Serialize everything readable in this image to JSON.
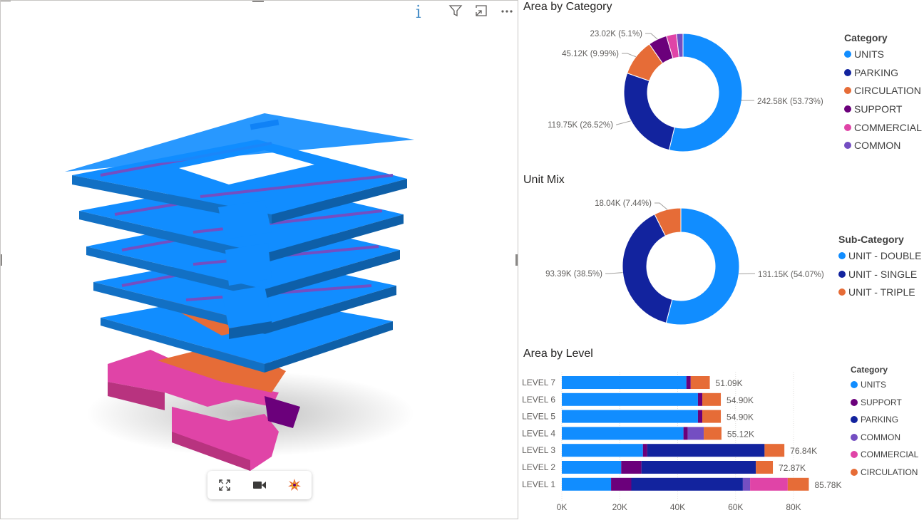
{
  "left_visual": {
    "info_glyph": "i",
    "header_icons": [
      "filter-icon",
      "focus-mode-icon",
      "more-options-icon"
    ],
    "toolbar_icons": [
      "expand-icon",
      "camera-icon",
      "explode-icon"
    ]
  },
  "colors": {
    "units": "#118DFF",
    "parking": "#12239E",
    "circulation": "#E66C37",
    "support": "#6B007B",
    "commercial": "#E044A7",
    "common": "#744EC2",
    "gridline": "#e1dfdd"
  },
  "chart_data": [
    {
      "type": "pie",
      "variant": "donut",
      "title": "Area by Category",
      "legend_title": "Category",
      "legend_position": "right",
      "categories": [
        "UNITS",
        "PARKING",
        "CIRCULATION",
        "SUPPORT",
        "COMMERCIAL",
        "COMMON"
      ],
      "values": [
        242.58,
        119.75,
        45.12,
        23.02,
        12.5,
        8.0
      ],
      "unit": "K",
      "data_labels": [
        "242.58K (53.73%)",
        "119.75K (26.52%)",
        "45.12K (9.99%)",
        "23.02K (5.1%)",
        "",
        ""
      ]
    },
    {
      "type": "pie",
      "variant": "donut",
      "title": "Unit Mix",
      "legend_title": "Sub-Category",
      "legend_position": "right",
      "categories": [
        "UNIT - DOUBLE",
        "UNIT - SINGLE",
        "UNIT - TRIPLE"
      ],
      "values": [
        131.15,
        93.39,
        18.04
      ],
      "unit": "K",
      "data_labels": [
        "131.15K (54.07%)",
        "93.39K (38.5%)",
        "18.04K (7.44%)"
      ]
    },
    {
      "type": "bar",
      "orientation": "horizontal",
      "stacked": true,
      "title": "Area by Level",
      "legend_title": "Category",
      "legend_position": "right",
      "categories": [
        "LEVEL 7",
        "LEVEL 6",
        "LEVEL 5",
        "LEVEL 4",
        "LEVEL 3",
        "LEVEL 2",
        "LEVEL 1"
      ],
      "series": [
        {
          "name": "UNITS",
          "values": [
            43,
            47,
            47,
            42,
            28,
            20.5,
            17
          ]
        },
        {
          "name": "SUPPORT",
          "values": [
            1.5,
            1.5,
            1.5,
            1.5,
            1.5,
            7,
            7
          ]
        },
        {
          "name": "PARKING",
          "values": [
            0,
            0,
            0,
            0,
            40.5,
            39.5,
            38.5
          ]
        },
        {
          "name": "COMMON",
          "values": [
            0,
            0,
            0,
            5.5,
            0,
            0,
            2.5
          ]
        },
        {
          "name": "COMMERCIAL",
          "values": [
            0,
            0,
            0,
            0,
            0,
            0,
            13
          ]
        },
        {
          "name": "CIRCULATION",
          "values": [
            6.59,
            6.4,
            6.4,
            6.12,
            6.84,
            5.87,
            7.28
          ]
        }
      ],
      "totals_labels": [
        "51.09K",
        "54.90K",
        "54.90K",
        "55.12K",
        "76.84K",
        "72.87K",
        "85.78K"
      ],
      "x_ticks": [
        "0K",
        "20K",
        "40K",
        "60K",
        "80K"
      ],
      "xlim": [
        0,
        80
      ],
      "grid": true
    }
  ]
}
